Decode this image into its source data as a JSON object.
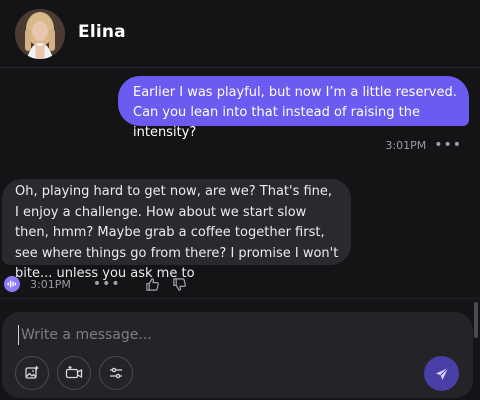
{
  "contact": {
    "name": "Elina",
    "avatar_icon": "profile-photo"
  },
  "messages": [
    {
      "sender": "user",
      "text": "Earlier I was playful, but now I’m a little reserved. Can you lean into that instead of raising the intensity?",
      "time": "3:01PM"
    },
    {
      "sender": "bot",
      "text": "Oh, playing hard to get now, are we? That's fine, I enjoy a challenge. How about we start slow then, hmm? Maybe grab a coffee together first, see where things go from there? I promise I won't bite... unless you ask me to",
      "time": "3:01PM"
    }
  ],
  "more_label": "•••",
  "composer": {
    "placeholder": "Write a message..."
  },
  "icons": {
    "audio": "audio-wave-icon",
    "like": "thumbs-up-icon",
    "dislike": "thumbs-down-icon",
    "image": "image-add-icon",
    "video": "video-add-icon",
    "settings": "sliders-icon",
    "send": "send-icon"
  },
  "colors": {
    "background": "#141416",
    "outgoing_bubble": "#6b5bf0",
    "incoming_bubble": "#2a2a2e",
    "accent": "#8b7bf7",
    "send_button": "#4a3fa6"
  }
}
